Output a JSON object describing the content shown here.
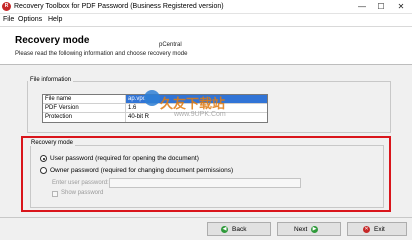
{
  "window": {
    "title": "Recovery Toolbox for PDF Password (Business Registered version)",
    "app_icon": "recovery-toolbox-icon",
    "minimize_glyph": "—",
    "maximize_glyph": "☐",
    "close_glyph": "✕"
  },
  "menu": {
    "items": [
      "File",
      "Options",
      "Help"
    ]
  },
  "header": {
    "title": "Recovery mode",
    "subtitle": "Please read the following information and choose recovery mode",
    "watermark": "pCentral"
  },
  "file_info": {
    "label": "File information",
    "rows": [
      {
        "key": "File name",
        "value": "ap.vpc"
      },
      {
        "key": "PDF Version",
        "value": "1.6"
      },
      {
        "key": "Protection",
        "value": "40-bit R"
      }
    ]
  },
  "recovery_mode": {
    "label": "Recovery mode",
    "options": [
      {
        "label": "User password (required for opening the document)",
        "selected": true
      },
      {
        "label": "Owner password (required for changing document permissions)",
        "selected": false
      }
    ],
    "user_password_label": "Enter user password:",
    "user_password_value": "",
    "show_password_label": "Show password",
    "show_password_checked": false
  },
  "overlay_watermark": {
    "text": "久友下载站",
    "url": "www.9UPK.Com"
  },
  "buttons": {
    "back": "Back",
    "next": "Next",
    "exit": "Exit"
  },
  "colors": {
    "highlight_box": "#d9151b",
    "selection": "#3174d6"
  }
}
